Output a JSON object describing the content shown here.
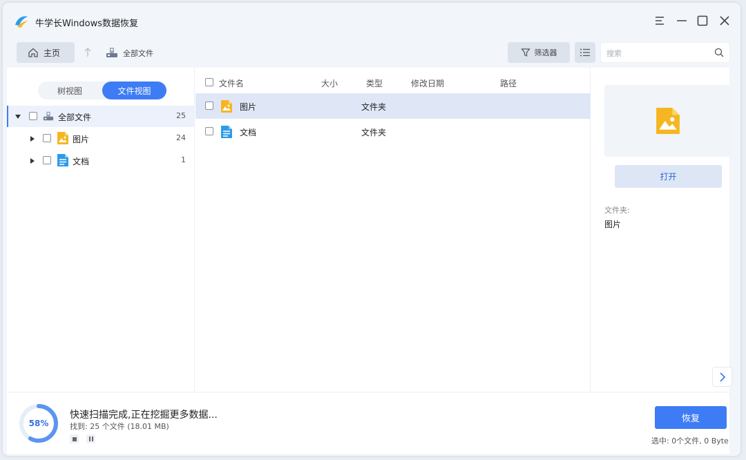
{
  "window": {
    "title": "牛学长Windows数据恢复",
    "buttons": [
      "menu-icon",
      "minimize-icon",
      "maximize-icon",
      "close-icon"
    ]
  },
  "toolbar": {
    "home_label": "主页",
    "breadcrumb_label": "全部文件",
    "filter_label": "筛选器",
    "search_placeholder": "搜索"
  },
  "sidebar": {
    "tabs": [
      {
        "label": "树视图",
        "active": false
      },
      {
        "label": "文件视图",
        "active": true
      }
    ],
    "tree": [
      {
        "label": "全部文件",
        "count": "25",
        "icon": "drive-icon",
        "expanded": true,
        "selected": true
      },
      {
        "label": "图片",
        "count": "24",
        "icon": "image-file-icon",
        "expanded": false,
        "selected": false
      },
      {
        "label": "文档",
        "count": "1",
        "icon": "document-file-icon",
        "expanded": false,
        "selected": false
      }
    ]
  },
  "file_list": {
    "columns": [
      "文件名",
      "大小",
      "类型",
      "修改日期",
      "路径"
    ],
    "rows": [
      {
        "name": "图片",
        "type": "文件夹",
        "icon": "image-file-icon",
        "selected": true
      },
      {
        "name": "文档",
        "type": "文件夹",
        "icon": "document-file-icon",
        "selected": false
      }
    ]
  },
  "preview": {
    "open_label": "打开",
    "folder_label": "文件夹:",
    "folder_value": "图片"
  },
  "status": {
    "progress_percent": 58,
    "progress_text": "58%",
    "scan_text": "快速扫描完成,正在挖掘更多数据...",
    "found_text": "找到: 25 个文件 (18.01 MB)",
    "recover_label": "恢复",
    "selected_text": "选中: 0个文件, 0 Byte"
  },
  "colors": {
    "accent": "#3d7cf4",
    "image_icon": "#f5b622",
    "document_icon": "#2d9bea"
  }
}
